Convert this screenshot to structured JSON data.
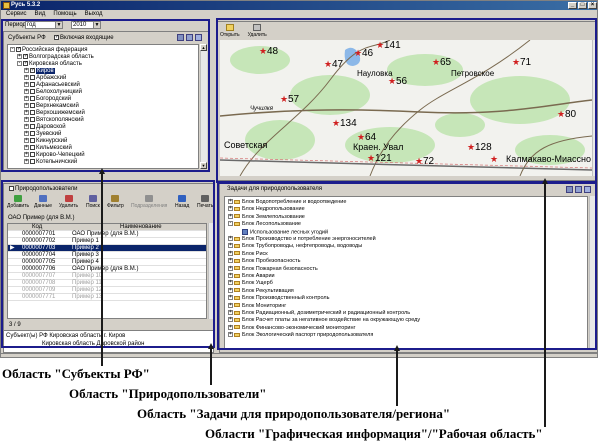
{
  "app": {
    "title": "Русь 5.3.2"
  },
  "menu": [
    "Сервис",
    "Вид",
    "Помощь",
    "Выход"
  ],
  "filter": {
    "period_label": "Период",
    "period_value": "год",
    "year_value": "2010"
  },
  "subjects": {
    "title": "Субъекты РФ",
    "include_label": "Включая входящие",
    "items": [
      {
        "label": "Российская федерация",
        "level": 0,
        "pm": "-"
      },
      {
        "label": "Волгоградская область",
        "level": 1,
        "pm": "+"
      },
      {
        "label": "Кировская область",
        "level": 1,
        "pm": "-"
      },
      {
        "label": "Киров",
        "level": 2,
        "pm": "+",
        "selected": true
      },
      {
        "label": "Арбажский",
        "level": 2,
        "pm": "+"
      },
      {
        "label": "Афанасьевский",
        "level": 2,
        "pm": "+"
      },
      {
        "label": "Белохолуницкий",
        "level": 2,
        "pm": "+"
      },
      {
        "label": "Богородский",
        "level": 2,
        "pm": "+"
      },
      {
        "label": "Верхнекамский",
        "level": 2,
        "pm": "+"
      },
      {
        "label": "Верхошижемский",
        "level": 2,
        "pm": "+"
      },
      {
        "label": "Вятскополянский",
        "level": 2,
        "pm": "+"
      },
      {
        "label": "Даровской",
        "level": 2,
        "pm": "+"
      },
      {
        "label": "Зуевский",
        "level": 2,
        "pm": "+"
      },
      {
        "label": "Кикнурский",
        "level": 2,
        "pm": "+"
      },
      {
        "label": "Кильмезский",
        "level": 2,
        "pm": "+"
      },
      {
        "label": "Кирово-Чепецкий",
        "level": 2,
        "pm": "+"
      },
      {
        "label": "Котельничский",
        "level": 2,
        "pm": "+"
      }
    ]
  },
  "users": {
    "title": "Природопользователи",
    "toolbar": [
      "Добавить",
      "Данные",
      "Удалить",
      "Поиск",
      "Фильтр",
      "Подразделения",
      "Назад",
      "Печать"
    ],
    "org_line": "ОАО Пример (для В.М.)",
    "columns": [
      "Код",
      "Наименование"
    ],
    "rows": [
      {
        "code": "0000007701",
        "name": "ОАО Пример (для В.М.)"
      },
      {
        "code": "0000007702",
        "name": "Пример 1"
      },
      {
        "code": "0000007703",
        "name": "Пример 2",
        "selected": true
      },
      {
        "code": "0000007704",
        "name": "Пример 3"
      },
      {
        "code": "0000007705",
        "name": "Пример 4"
      },
      {
        "code": "0000007706",
        "name": "ОАО Пример (для В.М.)"
      },
      {
        "code": "0000007707",
        "name": "Пример 10"
      },
      {
        "code": "0000007708",
        "name": "Пример 11"
      },
      {
        "code": "0000007709",
        "name": "Пример 12"
      },
      {
        "code": "0000007771",
        "name": "Пример 13"
      }
    ],
    "counter": "3 / 9",
    "footer": [
      {
        "k": "Субъект(ы) РФ",
        "v": "Кировская область г. Киров"
      },
      {
        "k": "",
        "v": "Кировская область Даровской район"
      }
    ]
  },
  "map": {
    "toolbar": [
      "Открыть",
      "Удалить"
    ],
    "markers": [
      "48",
      "46",
      "141",
      "47",
      "Науловка",
      "56",
      "65",
      "Петровское",
      "71",
      "57",
      "Чучилкя",
      "80",
      "134",
      "64",
      "Советская",
      "Краен. Увал",
      "121",
      "128",
      "72",
      "Калмакаво-Миассно"
    ]
  },
  "tasks": {
    "title": "Задачи для природопользователя",
    "items": [
      {
        "label": "Блок Водопотребление и водоотведение",
        "level": 0
      },
      {
        "label": "Блок Недропользование",
        "level": 0
      },
      {
        "label": "Блок Землепользование",
        "level": 0
      },
      {
        "label": "Блок Лесопользование",
        "level": 0,
        "open": true
      },
      {
        "label": "Использование лесных угодий",
        "level": 1,
        "doc": true
      },
      {
        "label": "Блок Производство и потребление энергоносителей",
        "level": 0
      },
      {
        "label": "Блок Трубопроводы, нефтепроводы, водоводы",
        "level": 0
      },
      {
        "label": "Блок Риск",
        "level": 0
      },
      {
        "label": "Блок Пробезопасность",
        "level": 0
      },
      {
        "label": "Блок Пожарная безопасность",
        "level": 0
      },
      {
        "label": "Блок Аварии",
        "level": 0
      },
      {
        "label": "Блок Ущерб",
        "level": 0
      },
      {
        "label": "Блок Рекультивация",
        "level": 0
      },
      {
        "label": "Блок Производственный контроль",
        "level": 0
      },
      {
        "label": "Блок Мониторинг",
        "level": 0
      },
      {
        "label": "Блок Радиационный, дозиметрический и радиационный контроль",
        "level": 0
      },
      {
        "label": "Блок Расчет платы за негативное воздействие на окружающую среду",
        "level": 0
      },
      {
        "label": "Блок Финансово-экономический мониторинг",
        "level": 0
      },
      {
        "label": "Блок Экологический паспорт природопользователя",
        "level": 0
      }
    ]
  },
  "captions": {
    "c1": "Область \"Субъекты РФ\"",
    "c2": "Область \"Природопользователи\"",
    "c3": "Область \"Задачи для природопользователя/региона\"",
    "c4": "Области \"Графическая информация\"/\"Рабочая область\""
  },
  "colors": {
    "titlebar": "#0a246a",
    "highlight_box": "#1c1c8c",
    "selection": "#0a246a"
  }
}
